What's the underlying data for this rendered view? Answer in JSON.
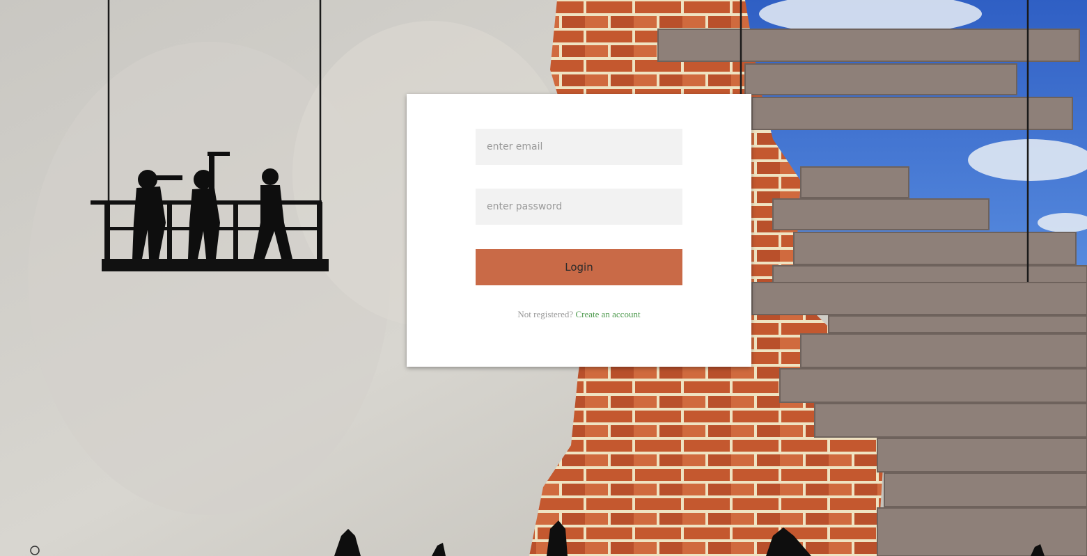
{
  "login_form": {
    "email_placeholder": "enter email",
    "password_placeholder": "enter password",
    "login_label": "Login",
    "not_registered_text": "Not registered?",
    "create_account_label": "Create an account"
  },
  "colors": {
    "login_button": "#c96a47",
    "link": "#4e9a4e",
    "input_background": "#f2f2f2"
  }
}
